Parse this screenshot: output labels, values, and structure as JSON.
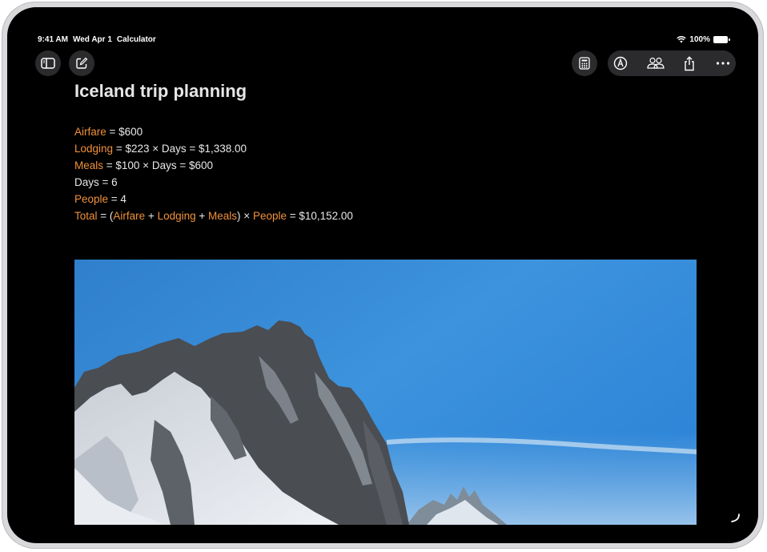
{
  "status": {
    "time": "9:41 AM",
    "date": "Wed Apr 1",
    "app": "Calculator",
    "battery": "100%"
  },
  "toolbar": {
    "left_buttons": [
      "sidebar-icon",
      "compose-icon"
    ],
    "right_buttons": [
      "calculator-icon",
      "markup-pen-icon",
      "collaborate-icon",
      "share-icon",
      "more-icon"
    ]
  },
  "note": {
    "title": "Iceland trip planning",
    "airfare": {
      "name": "Airfare",
      "rest": " = $600"
    },
    "lodging": {
      "name": "Lodging",
      "rest": " = $223 × Days = $1,338.00"
    },
    "meals": {
      "name": "Meals",
      "rest": " = $100 × Days = $600"
    },
    "days": "Days = 6",
    "people": {
      "name": "People",
      "rest": " = 4"
    },
    "total": {
      "name": "Total",
      "eq_open": " = (",
      "airfare": "Airfare",
      "plus1": " + ",
      "lodging": "Lodging",
      "plus2": " + ",
      "meals": "Meals",
      "times": ") × ",
      "people": "People",
      "result": " = $10,152.00"
    }
  },
  "colors": {
    "variable": "#f0913a",
    "text": "#e8e8e8",
    "background": "#000000",
    "button": "#2b2b2e"
  },
  "image": {
    "subject": "snow-covered mountain peaks under a blue sky"
  }
}
